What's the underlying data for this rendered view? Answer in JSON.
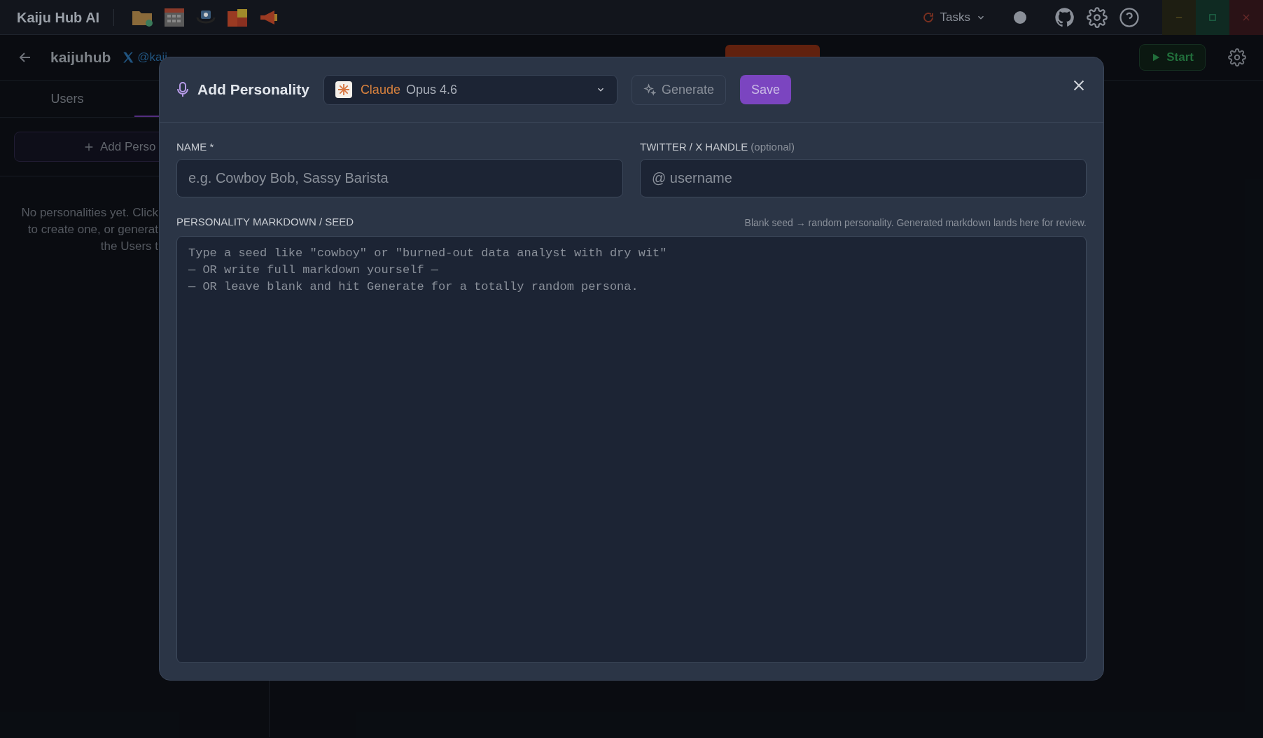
{
  "window": {
    "title": "Kaiju Hub AI",
    "tasks_label": "Tasks"
  },
  "header": {
    "account": "kaijuhub",
    "handle": "@kaij",
    "start_label": "Start"
  },
  "sidebar": {
    "tabs": [
      {
        "label": "Users",
        "selected": false
      },
      {
        "selected": true
      }
    ],
    "add_button": "Add Perso",
    "empty_lines": [
      "No personalities yet. Click",
      "to create one, or generat",
      "the Users t"
    ]
  },
  "modal": {
    "title": "Add Personality",
    "model": {
      "provider": "Claude",
      "name": "Opus 4.6"
    },
    "generate_label": "Generate",
    "save_label": "Save",
    "name_field": {
      "label": "NAME *",
      "placeholder": "e.g. Cowboy Bob, Sassy Barista"
    },
    "handle_field": {
      "label": "TWITTER / X HANDLE",
      "hint": "(optional)",
      "placeholder": "@ username"
    },
    "markdown_field": {
      "label": "PERSONALITY MARKDOWN / SEED",
      "hint": "Blank seed → random personality. Generated markdown lands here for review.",
      "placeholder": "Type a seed like \"cowboy\" or \"burned-out data analyst with dry wit\"\n— OR write full markdown yourself —\n— OR leave blank and hit Generate for a totally random persona."
    }
  }
}
